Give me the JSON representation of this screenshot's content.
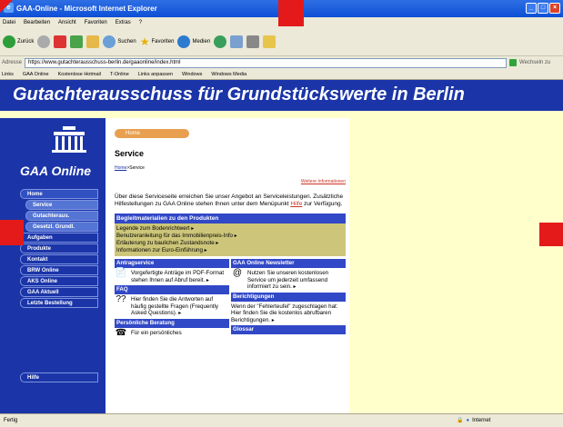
{
  "window": {
    "title": "GAA-Online - Microsoft Internet Explorer",
    "min": "_",
    "max": "□",
    "close": "×"
  },
  "menu": [
    "Datei",
    "Bearbeiten",
    "Ansicht",
    "Favoriten",
    "Extras",
    "?"
  ],
  "toolbar": {
    "back": "Zurück",
    "search": "Suchen",
    "favorites": "Favoriten",
    "media": "Medien"
  },
  "address": {
    "label": "Adresse",
    "url": "https://www.gutachterausschuss-berlin.de/gaaonline/index.html",
    "go": "Wechseln zu"
  },
  "links": {
    "label": "Links",
    "items": [
      "GAA Online",
      "Kostenlose Hotmail",
      "T-Online",
      "Links anpassen",
      "Windows",
      "Windows Media"
    ]
  },
  "banner": {
    "title": "Gutachterausschuss für Grundstückswerte in Berlin"
  },
  "sidebar": {
    "brand": "GAA Online",
    "items": [
      {
        "label": "Home"
      },
      {
        "label": "Service"
      },
      {
        "label": "Gutachteraus."
      },
      {
        "label": "Gesetzl. Grundl."
      },
      {
        "label": "Aufgaben"
      },
      {
        "label": "Produkte"
      },
      {
        "label": "Kontakt"
      },
      {
        "label": "BRW Online"
      },
      {
        "label": "AKS Online"
      },
      {
        "label": "GAA Aktuell"
      },
      {
        "label": "Letzte Bestellung"
      }
    ],
    "help": "Hilfe"
  },
  "main": {
    "home_pill": "Home",
    "title": "Service",
    "breadcrumb_home": "Home",
    "breadcrumb_current": ">Service",
    "more_info": "Weitere Informationen",
    "intro_text": "Über diese Serviceseite erreichen Sie unser Angebot an Serviceleistungen. Zusätzliche Hilfestellungen zu GAA Online stehen Ihnen unter dem Menüpunkt",
    "intro_link": "Hilfe",
    "intro_end": "zur Verfügung.",
    "begleit_header": "Begleitmaterialien zu den Produkten",
    "begleit_items": [
      "Legende zum Bodenrichtwert ▸",
      "Benutzeranleitung für das Immobilienpreis-Info ▸",
      "Erläuterung zu baulichen Zustandsnote ▸",
      "Informationen zur Euro-Einführung ▸"
    ],
    "left_sections": [
      {
        "header": "Antragservice",
        "text": "Vorgefertigte Anträge im PDF-Format stehen Ihnen auf Abruf bereit. ▸"
      },
      {
        "header": "FAQ",
        "text": "Hier finden Sie die Antworten auf häufig gestellte Fragen (Frequently Asked Questions). ▸"
      },
      {
        "header": "Persönliche Beratung",
        "text": "Für ein persönliches"
      }
    ],
    "right_sections": [
      {
        "header": "GAA Online Newsletter",
        "text": "Nutzen Sie unseren kostenlosen Service um jederzeit umfassend informiert zu sein. ▸"
      },
      {
        "header": "Berichtigungen",
        "text": "Wenn der \"Fehlerteufel\" zugeschlagen hat: Hier finden Sie die kostenlos abrufbaren Berichtigungen. ▸"
      },
      {
        "header": "Glossar",
        "text": ""
      }
    ]
  },
  "status": {
    "left": "Fertig",
    "right": "Internet"
  },
  "colors": {
    "nav_blue": "#1b35a8",
    "page_bg": "#ffffcc",
    "olive": "#cdc67a",
    "marker_red": "#e41a1a"
  }
}
